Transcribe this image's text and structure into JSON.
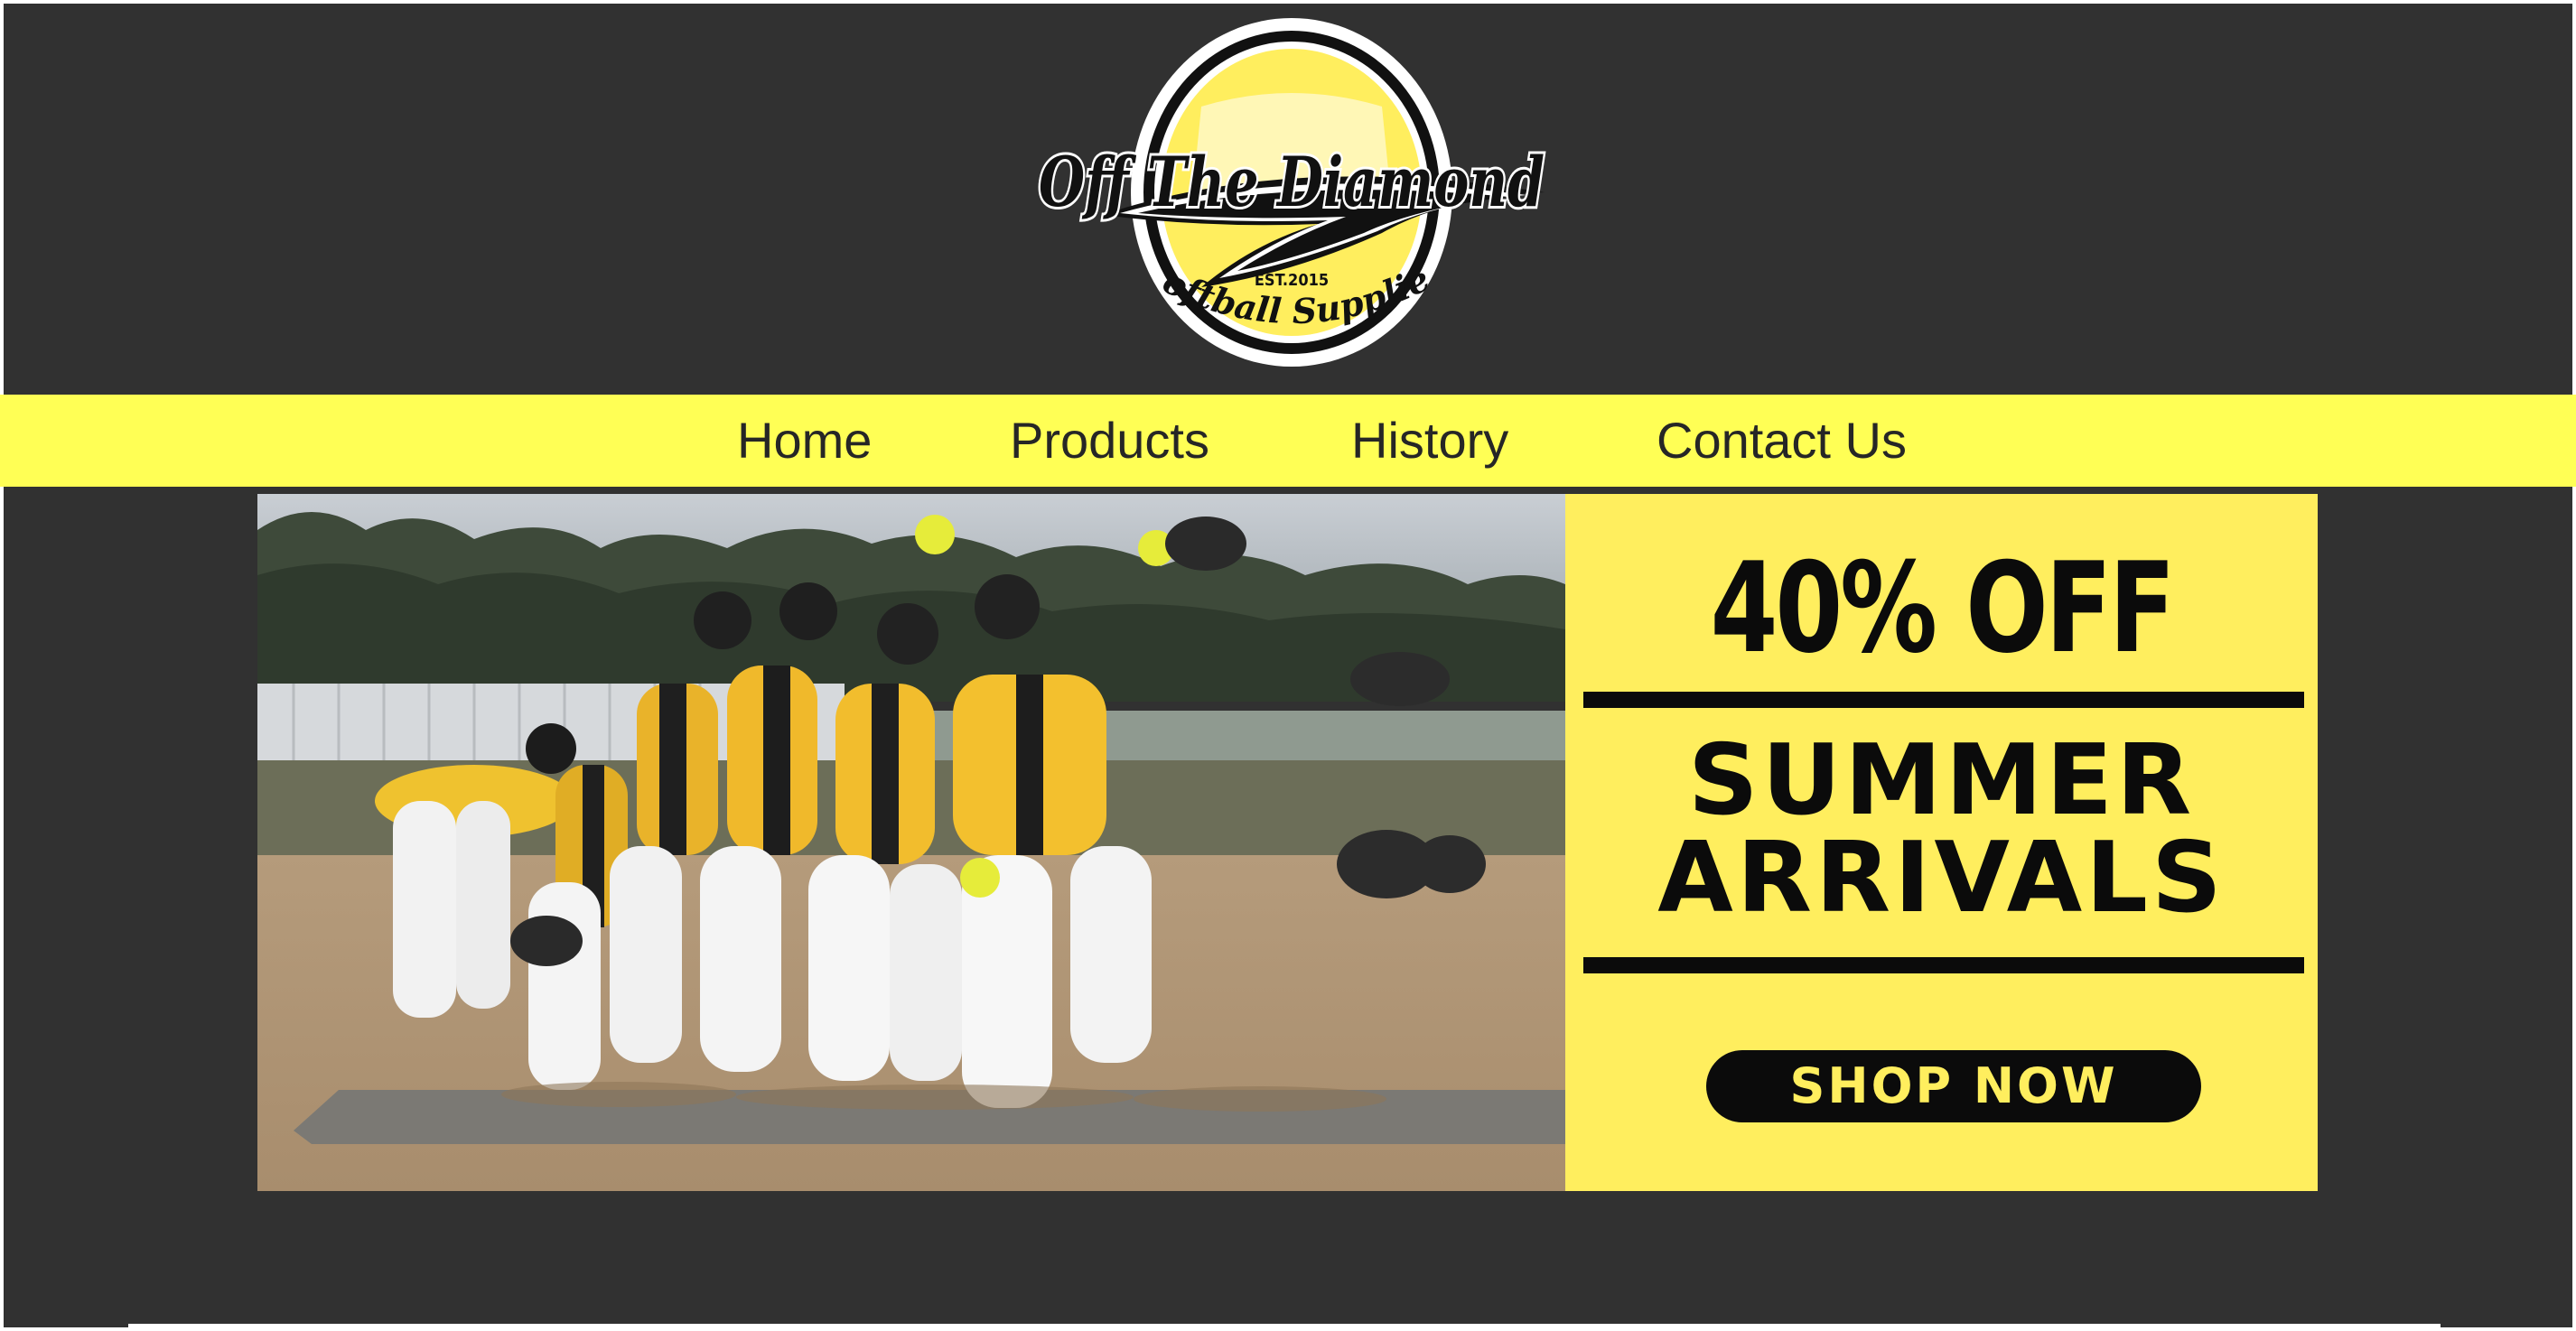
{
  "brand": {
    "logo_script": "Off The Diamond",
    "logo_est": "EST.2015",
    "logo_tagline": "Softball Supplies"
  },
  "nav": {
    "items": [
      {
        "label": "Home"
      },
      {
        "label": "Products"
      },
      {
        "label": "History"
      },
      {
        "label": "Contact Us"
      }
    ]
  },
  "promo": {
    "discount": "40% OFF",
    "headline_line1": "SUMMER",
    "headline_line2": "ARRIVALS",
    "cta": "SHOP NOW"
  },
  "colors": {
    "background": "#313131",
    "nav_background": "#ffff55",
    "promo_background": "#ffee5e",
    "text_dark": "#0b0b0b"
  }
}
